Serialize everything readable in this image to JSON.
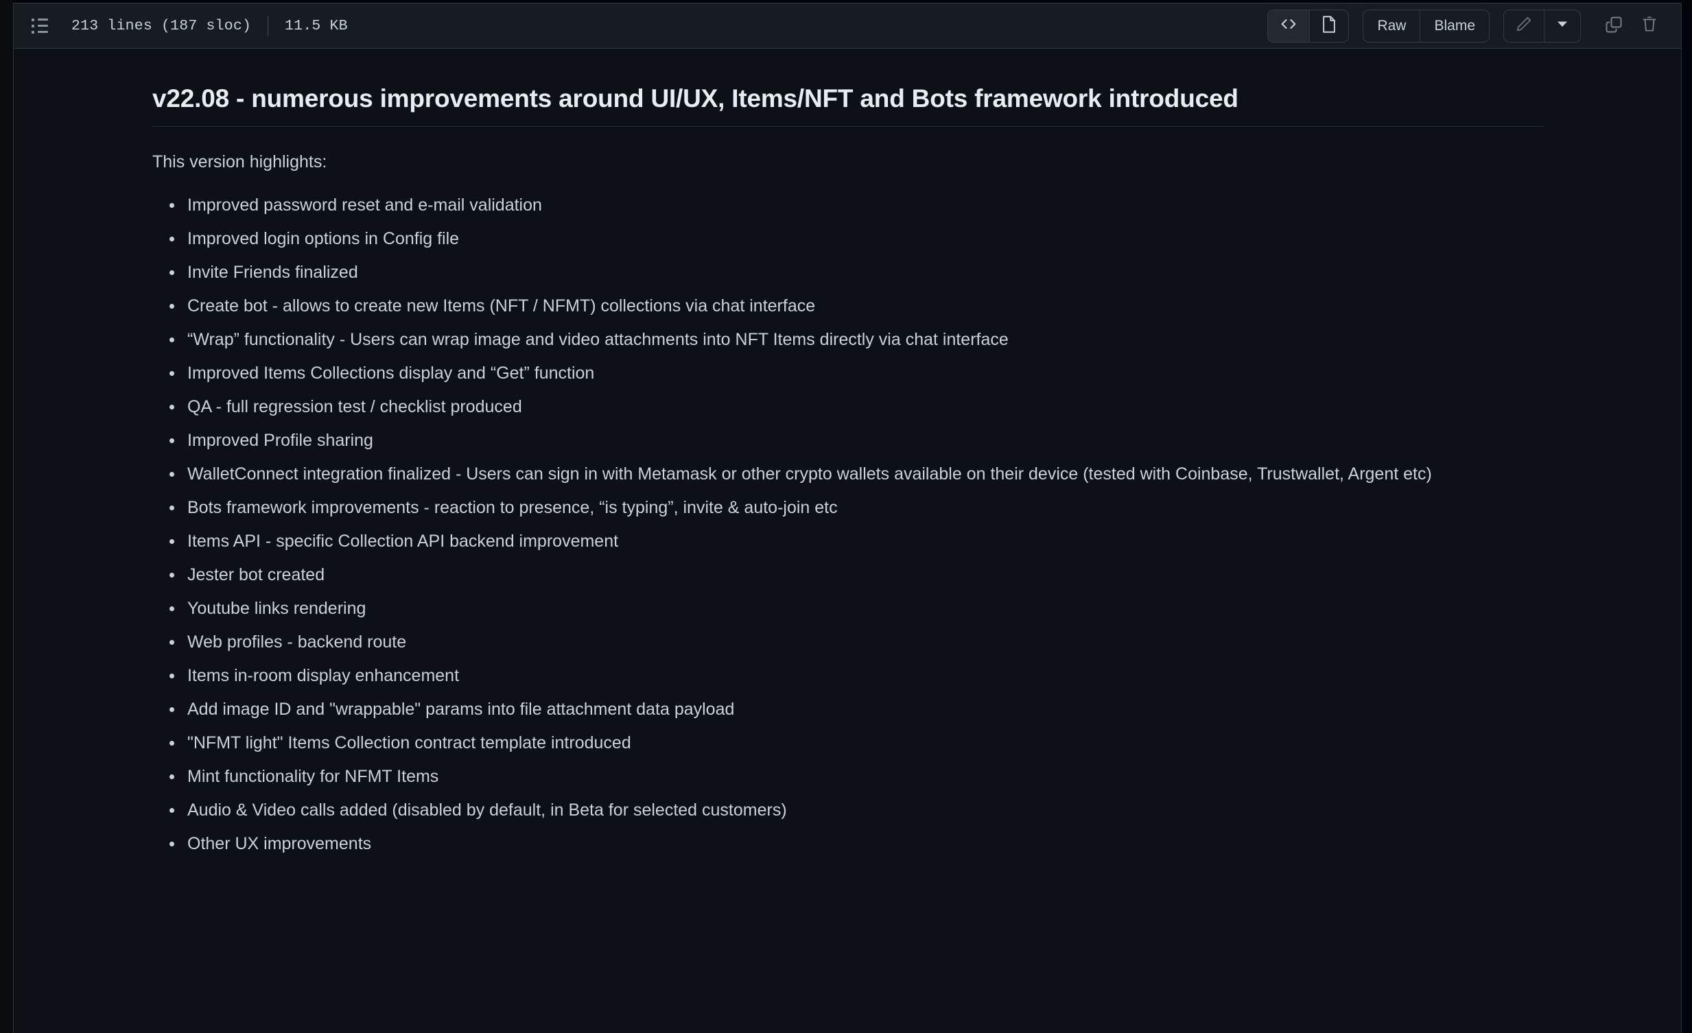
{
  "header": {
    "list_icon": "list-unordered-icon",
    "lines_info": "213 lines (187 sloc)",
    "file_size": "11.5 KB",
    "actions": {
      "code_view_label": "code-icon",
      "preview_view_label": "file-preview-icon",
      "raw_label": "Raw",
      "blame_label": "Blame",
      "edit_label": "pencil-icon",
      "edit_dropdown_label": "chevron-down-icon",
      "copy_label": "copy-icon",
      "delete_label": "trash-icon"
    }
  },
  "content": {
    "title": "v22.08 - numerous improvements around UI/UX, Items/NFT and Bots framework introduced",
    "intro": "This version highlights:",
    "highlights": [
      "Improved password reset and e-mail validation",
      "Improved login options in Config file",
      "Invite Friends finalized",
      "Create bot - allows to create new Items (NFT / NFMT) collections via chat interface",
      "“Wrap” functionality - Users can wrap image and video attachments into NFT Items directly via chat interface",
      "Improved Items Collections display and “Get” function",
      "QA - full regression test / checklist produced",
      "Improved Profile sharing",
      "WalletConnect integration finalized - Users can sign in with Metamask or other crypto wallets available on their device (tested with Coinbase, Trustwallet, Argent etc)",
      "Bots framework improvements - reaction to presence, “is typing”, invite & auto-join etc",
      "Items API - specific Collection API backend improvement",
      "Jester bot created",
      "Youtube links rendering",
      "Web profiles - backend route",
      "Items in-room display enhancement",
      "Add image ID and \"wrappable\" params into file attachment data payload",
      "\"NFMT light\" Items Collection contract template introduced",
      "Mint functionality for NFMT Items",
      "Audio & Video calls added (disabled by default, in Beta for selected customers)",
      "Other UX improvements"
    ]
  },
  "colors": {
    "page_background": "#0d1117",
    "header_background": "#171b22",
    "border": "#30363d",
    "text_primary": "#c9d1d9",
    "text_heading": "#e6edf3",
    "icon_muted": "#8b949e"
  }
}
